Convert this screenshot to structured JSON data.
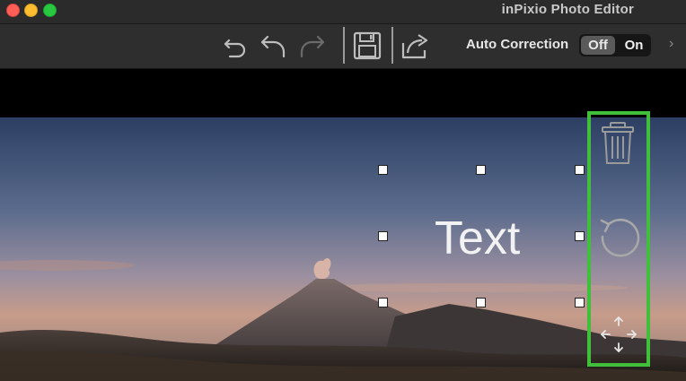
{
  "window": {
    "title": "inPixio Photo Editor"
  },
  "toolbar": {
    "icons": [
      "undo-icon",
      "undo-step-icon",
      "redo-icon",
      "save-icon",
      "share-icon"
    ],
    "auto_correction_label": "Auto Correction",
    "toggle_off_label": "Off",
    "toggle_on_label": "On",
    "toggle_selected": "Off",
    "more_icon": "chevron-right-icon"
  },
  "canvas": {
    "text_object": "Text"
  },
  "side_panel": {
    "icons": [
      "trash-icon",
      "rotate-icon",
      "move-icon"
    ],
    "highlight_color": "#3fbf3a"
  },
  "colors": {
    "titlebar": "#2b2b2b",
    "toolbar": "#2e2e2e",
    "close": "#ff5f57",
    "minimize": "#febc2e",
    "zoom": "#28c840"
  }
}
